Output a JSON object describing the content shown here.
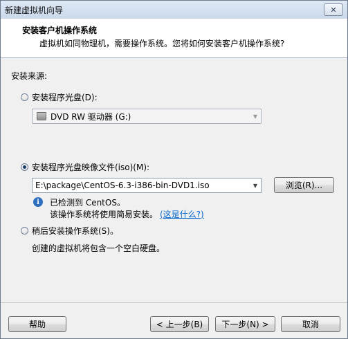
{
  "window": {
    "title": "新建虚拟机向导",
    "close_label": "✕"
  },
  "header": {
    "title": "安装客户机操作系统",
    "subtitle": "虚拟机如同物理机，需要操作系统。您将如何安装客户机操作系统?"
  },
  "source": {
    "label": "安装来源:",
    "disc_option": "安装程序光盘(D):",
    "disc_drive": "DVD RW 驱动器 (G:)",
    "iso_option": "安装程序光盘映像文件(iso)(M):",
    "iso_path": "E:\\package\\CentOS-6.3-i386-bin-DVD1.iso",
    "browse_label": "浏览(R)...",
    "detected_text": "已检测到 CentOS。",
    "easy_install_text": "该操作系统将使用简易安装。",
    "whats_this_link": "(这是什么?)",
    "later_option": "稍后安装操作系统(S)。",
    "later_desc": "创建的虚拟机将包含一个空白硬盘。",
    "selected": "iso"
  },
  "footer": {
    "help_label": "帮助",
    "back_label": "< 上一步(B)",
    "next_label": "下一步(N) >",
    "cancel_label": "取消"
  },
  "colors": {
    "link": "#0066cc",
    "header_bg": "#ffffff",
    "body_bg": "#f0f0f0"
  }
}
